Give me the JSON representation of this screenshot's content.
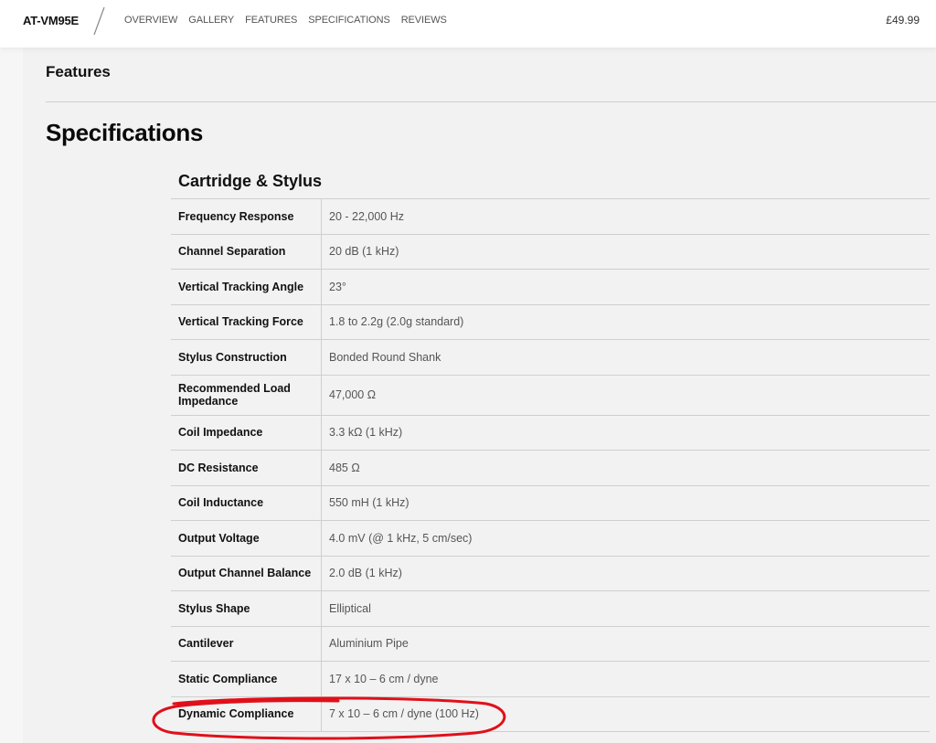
{
  "header": {
    "brand": "AT-VM95E",
    "nav": [
      "OVERVIEW",
      "GALLERY",
      "FEATURES",
      "SPECIFICATIONS",
      "REVIEWS"
    ],
    "price": "£49.99"
  },
  "content": {
    "features_heading": "Features",
    "specifications_heading": "Specifications",
    "group_title": "Cartridge & Stylus",
    "rows": [
      {
        "label": "Frequency Response",
        "value": "20 - 22,000 Hz"
      },
      {
        "label": "Channel Separation",
        "value": "20 dB (1 kHz)"
      },
      {
        "label": "Vertical Tracking Angle",
        "value": "23°"
      },
      {
        "label": "Vertical Tracking Force",
        "value": "1.8 to 2.2g (2.0g standard)"
      },
      {
        "label": "Stylus Construction",
        "value": "Bonded Round Shank"
      },
      {
        "label": "Recommended Load Impedance",
        "value": "47,000 Ω"
      },
      {
        "label": "Coil Impedance",
        "value": "3.3 kΩ (1 kHz)"
      },
      {
        "label": "DC Resistance",
        "value": "485 Ω"
      },
      {
        "label": "Coil Inductance",
        "value": "550 mH (1 kHz)"
      },
      {
        "label": "Output Voltage",
        "value": "4.0 mV (@ 1 kHz, 5 cm/sec)"
      },
      {
        "label": "Output Channel Balance",
        "value": "2.0 dB (1 kHz)"
      },
      {
        "label": "Stylus Shape",
        "value": "Elliptical"
      },
      {
        "label": "Cantilever",
        "value": "Aluminium Pipe"
      },
      {
        "label": "Static Compliance",
        "value": "17 x 10 – 6 cm / dyne"
      },
      {
        "label": "Dynamic Compliance",
        "value": "7 x 10 – 6 cm / dyne (100 Hz)"
      }
    ]
  },
  "annotation": {
    "color": "#e0101a",
    "icon": "hand-drawn-ellipse-highlight"
  }
}
